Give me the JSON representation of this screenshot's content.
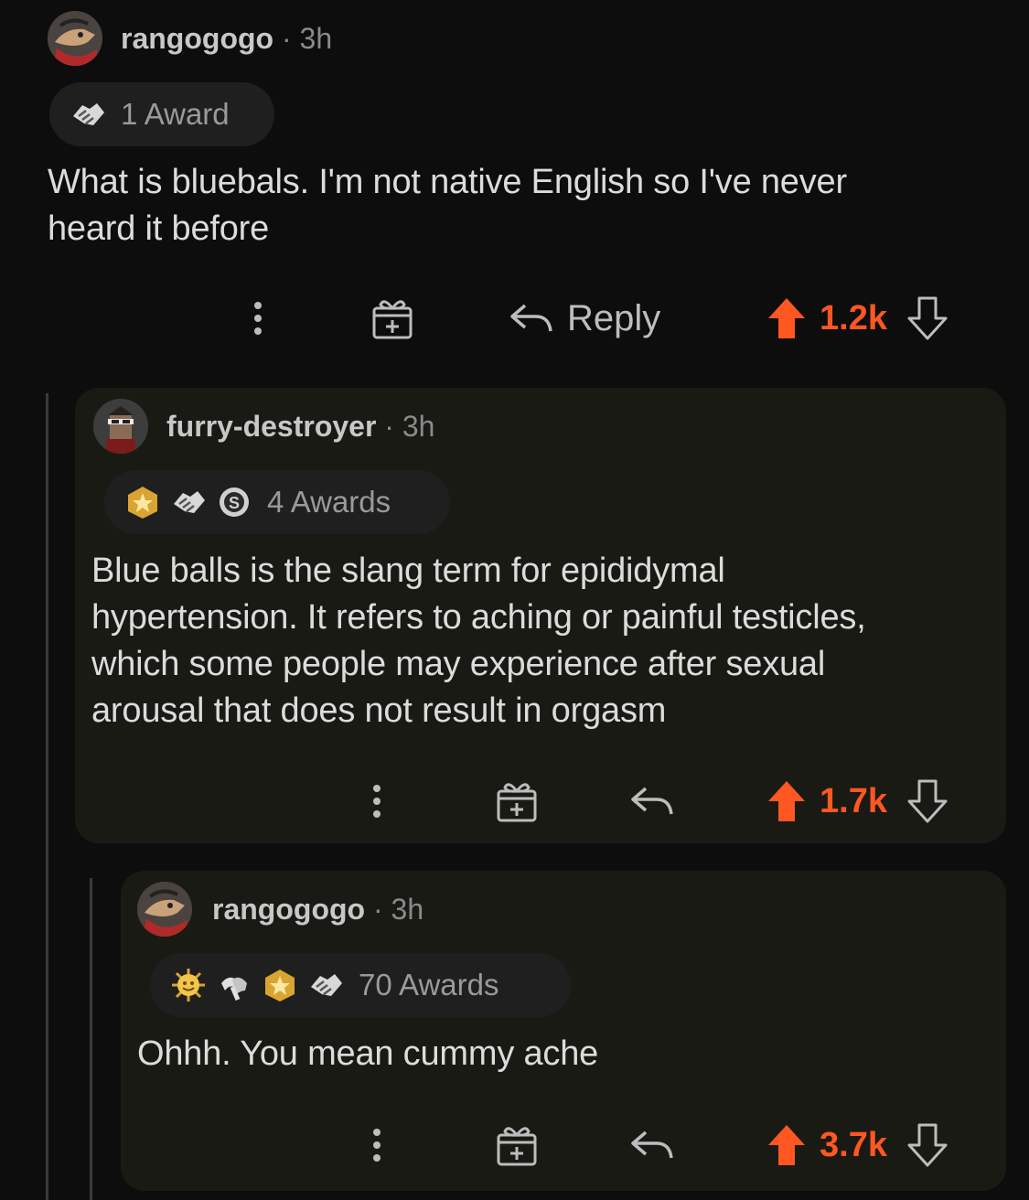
{
  "comments": [
    {
      "username": "rangogogo",
      "separator": "·",
      "age": "3h",
      "awards_label": "1 Award",
      "body_lines": [
        "What is bluebals. I'm not native English so I've never",
        "heard it before"
      ],
      "reply_label": "Reply",
      "score": "1.2k"
    },
    {
      "username": "furry-destroyer",
      "separator": "·",
      "age": "3h",
      "awards_label": "4 Awards",
      "body_lines": [
        "Blue balls is the slang term for epididymal",
        "hypertension. It refers to aching or painful testicles,",
        "which some people may experience after sexual",
        "arousal that does not result in orgasm"
      ],
      "score": "1.7k"
    },
    {
      "username": "rangogogo",
      "separator": "·",
      "age": "3h",
      "awards_label": "70 Awards",
      "body_lines": [
        "Ohhh. You mean cummy ache"
      ],
      "score": "3.7k"
    }
  ],
  "colors": {
    "background": "#0d0d0d",
    "card": "#1a1a14",
    "upvote": "#ff5722",
    "muted": "#8a8a8a"
  },
  "icons": {
    "award_wholesome": "handshake-award-icon",
    "award_gold": "gold-award-icon",
    "award_silver": "silver-award-icon",
    "award_sun": "sun-award-icon",
    "award_hands": "hands-award-icon",
    "more": "more-options-icon",
    "gift": "gift-award-icon",
    "reply": "reply-arrow-icon",
    "upvote": "upvote-arrow-icon",
    "downvote": "downvote-arrow-icon"
  }
}
